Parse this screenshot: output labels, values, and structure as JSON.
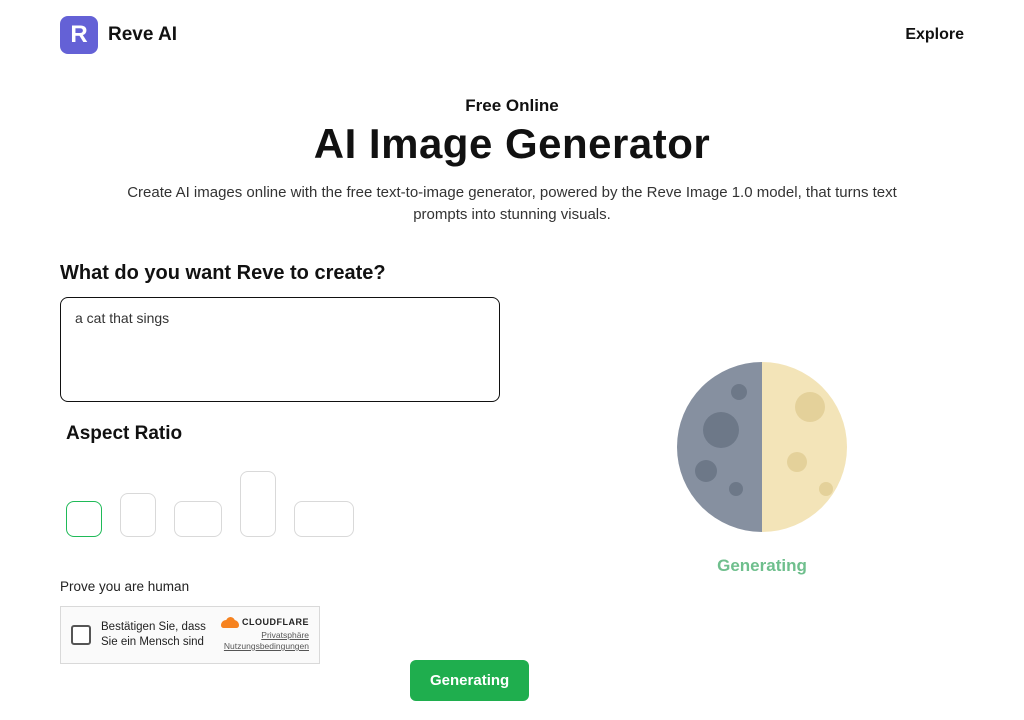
{
  "header": {
    "brand_name": "Reve AI",
    "logo_letter": "R",
    "explore_label": "Explore"
  },
  "hero": {
    "eyebrow": "Free Online",
    "title": "AI Image Generator",
    "subtitle": "Create AI images online with the free text-to-image generator, powered by the Reve Image 1.0 model, that turns text prompts into stunning visuals."
  },
  "prompt": {
    "label": "What do you want Reve to create?",
    "value": "a cat that sings"
  },
  "aspect": {
    "label": "Aspect Ratio",
    "selected_index": 0,
    "options": [
      "1:1",
      "3:4",
      "4:3",
      "9:16",
      "16:9"
    ]
  },
  "captcha": {
    "label": "Prove you are human",
    "text": "Bestätigen Sie, dass Sie ein Mensch sind",
    "provider": "CLOUDFLARE",
    "privacy_label": "Privatsphäre",
    "terms_label": "Nutzungsbedingungen"
  },
  "buttons": {
    "generate": "Generating"
  },
  "preview": {
    "status": "Generating"
  }
}
